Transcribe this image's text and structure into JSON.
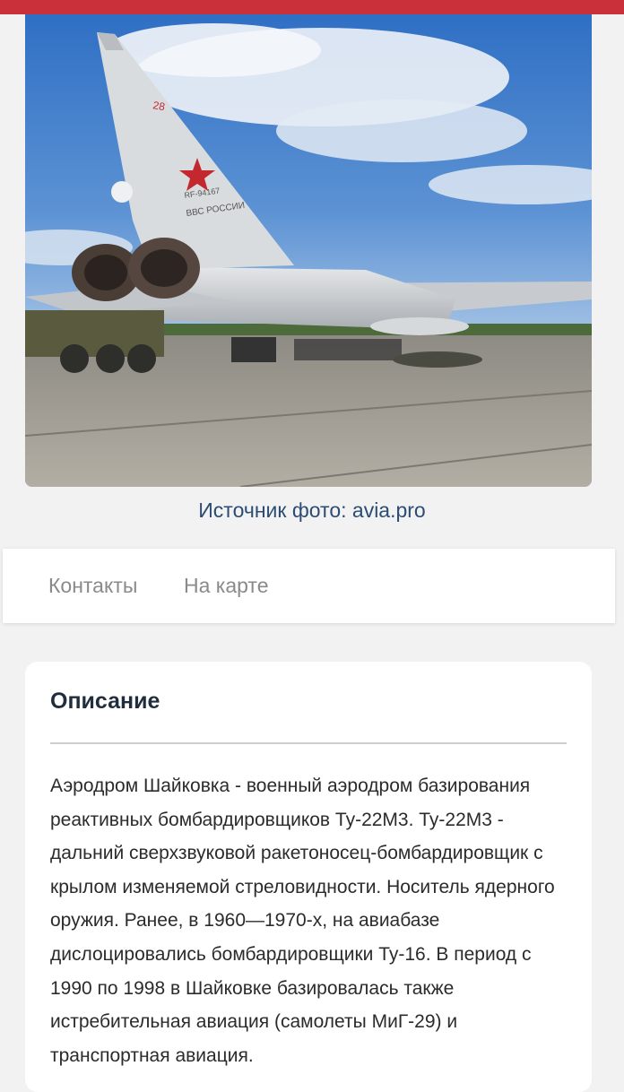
{
  "photo": {
    "subject": "Ту-22М3 bomber on airfield apron",
    "tail_number": "28",
    "registration": "RF-94167",
    "markings": "ВВС РОССИИ"
  },
  "caption": "Источник фото: avia.pro",
  "tabs": [
    "Контакты",
    "На карте"
  ],
  "description": {
    "title": "Описание",
    "text": "Аэродром Шайковка - военный аэродром базирования реактивных бомбардировщиков Ту-22М3. Ту-22М3 - дальний сверхзвуковой ракетоносец-бомбардировщик с крылом изменяемой стреловидности. Носитель ядерного оружия. Ранее, в 1960—1970-х, на авиабазе дислоцировались бомбардировщики Ту-16. В период с 1990 по 1998 в Шайковке базировалась также истребительная авиация (самолеты МиГ-29) и транспортная авиация."
  },
  "colors": {
    "top_bar": "#c9303a",
    "caption": "#2b4c74",
    "title": "#1f2d3d"
  }
}
